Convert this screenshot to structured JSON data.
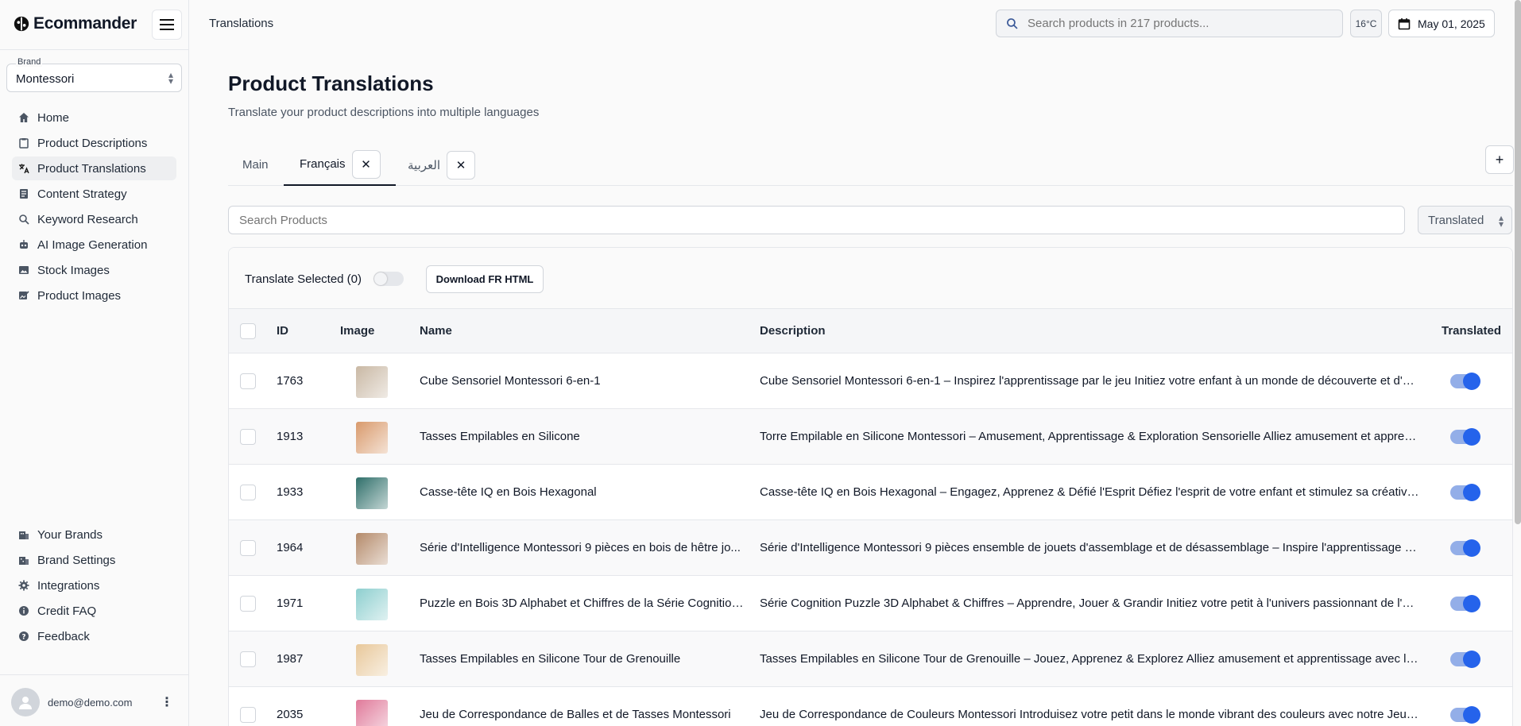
{
  "app": {
    "name": "Ecommander"
  },
  "brand": {
    "label": "Brand",
    "value": "Montessori"
  },
  "nav": [
    {
      "label": "Home",
      "icon": "home-icon"
    },
    {
      "label": "Product Descriptions",
      "icon": "clipboard-icon"
    },
    {
      "label": "Product Translations",
      "icon": "translate-icon",
      "active": true
    },
    {
      "label": "Content Strategy",
      "icon": "document-icon"
    },
    {
      "label": "Keyword Research",
      "icon": "search-icon"
    },
    {
      "label": "AI Image Generation",
      "icon": "robot-icon"
    },
    {
      "label": "Stock Images",
      "icon": "image-icon"
    },
    {
      "label": "Product Images",
      "icon": "image-edit-icon"
    }
  ],
  "nav_bottom": [
    {
      "label": "Your Brands",
      "icon": "building-icon"
    },
    {
      "label": "Brand Settings",
      "icon": "building-settings-icon"
    },
    {
      "label": "Integrations",
      "icon": "gear-icon"
    },
    {
      "label": "Credit FAQ",
      "icon": "info-icon"
    },
    {
      "label": "Feedback",
      "icon": "help-icon"
    }
  ],
  "user": {
    "email": "demo@demo.com",
    "more": "⋮"
  },
  "header": {
    "title": "Translations",
    "search_placeholder": "Search products in 217 products...",
    "temperature": "16°C",
    "date": "May 01, 2025"
  },
  "page": {
    "title": "Product Translations",
    "subtitle": "Translate your product descriptions into multiple languages"
  },
  "tabs": [
    {
      "label": "Main"
    },
    {
      "label": "Français",
      "active": true,
      "close": "✕"
    },
    {
      "label": "العربية",
      "close": "✕"
    }
  ],
  "tab_add": "+",
  "filters": {
    "search_placeholder": "Search Products",
    "status_value": "Translated"
  },
  "toolbar": {
    "translate_selected": "Translate Selected (0)",
    "download_label": "Download FR HTML"
  },
  "table": {
    "headers": {
      "id": "ID",
      "image": "Image",
      "name": "Name",
      "description": "Description",
      "translated": "Translated"
    },
    "rows": [
      {
        "id": "1763",
        "name": "Cube Sensoriel Montessori 6-en-1",
        "description": "Cube Sensoriel Montessori 6-en-1 – Inspirez l'apprentissage par le jeu Initiez votre enfant à un monde de découverte et d'ap...",
        "translated": true,
        "thumb": "#c9b8a4"
      },
      {
        "id": "1913",
        "name": "Tasses Empilables en Silicone",
        "description": "Torre Empilable en Silicone Montessori – Amusement, Apprentissage & Exploration Sensorielle Alliez amusement et apprentis...",
        "translated": true,
        "thumb": "#d99a6c"
      },
      {
        "id": "1933",
        "name": "Casse-tête IQ en Bois Hexagonal",
        "description": "Casse-tête IQ en Bois Hexagonal – Engagez, Apprenez & Défié l'Esprit Défiez l'esprit de votre enfant et stimulez sa créativité...",
        "translated": true,
        "thumb": "#2f6f6a"
      },
      {
        "id": "1964",
        "name": "Série d'Intelligence Montessori 9 pièces en bois de hêtre jo...",
        "description": "Série d'Intelligence Montessori 9 pièces ensemble de jouets d'assemblage et de désassemblage – Inspire l'apprentissage pa...",
        "translated": true,
        "thumb": "#b48a6a"
      },
      {
        "id": "1971",
        "name": "Puzzle en Bois 3D Alphabet et Chiffres de la Série Cognition...",
        "description": "Série Cognition Puzzle 3D Alphabet & Chiffres – Apprendre, Jouer & Grandir Initiez votre petit à l'univers passionnant de l'ap...",
        "translated": true,
        "thumb": "#8ecfcf"
      },
      {
        "id": "1987",
        "name": "Tasses Empilables en Silicone Tour de Grenouille",
        "description": "Tasses Empilables en Silicone Tour de Grenouille – Jouez, Apprenez & Explorez Alliez amusement et apprentissage avec la T...",
        "translated": true,
        "thumb": "#e8c89a"
      },
      {
        "id": "2035",
        "name": "Jeu de Correspondance de Balles et de Tasses Montessori",
        "description": "Jeu de Correspondance de Couleurs Montessori Introduisez votre petit dans le monde vibrant des couleurs avec notre Jeu d...",
        "translated": true,
        "thumb": "#e07a9a"
      }
    ]
  }
}
